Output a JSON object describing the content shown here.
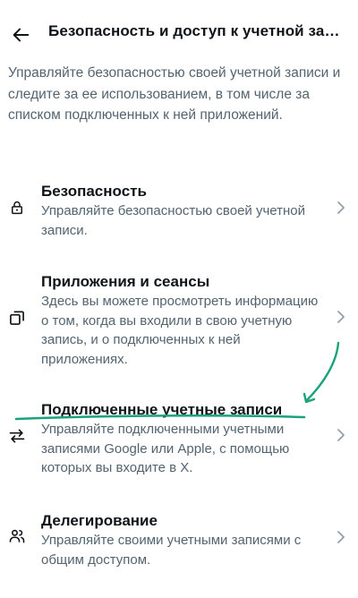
{
  "header": {
    "back_icon": "arrow-left-icon",
    "title": "Безопасность и доступ к учетной записи"
  },
  "intro": "Управляйте безопасностью своей учетной записи и следите за ее использованием, в том числе за списком подключенных к ней приложений.",
  "items": [
    {
      "icon": "lock-icon",
      "title": "Безопасность",
      "description": "Управляйте безопасностью своей учетной записи."
    },
    {
      "icon": "copy-windows-icon",
      "title": "Приложения и сеансы",
      "description": "Здесь вы можете просмотреть информацию о том, когда вы входили в свою учетную запись, и о подключенных к ней приложениях."
    },
    {
      "icon": "swap-arrows-icon",
      "title": "Подключенные учетные записи",
      "description": "Управляйте подключенными учетными записями Google или Apple, с помощью которых вы входите в X."
    },
    {
      "icon": "people-icon",
      "title": "Делегирование",
      "description": "Управляйте своими учетными записями с общим доступом."
    }
  ],
  "colors": {
    "text_primary": "#0f1419",
    "text_secondary": "#536471",
    "chevron": "#8b98a5",
    "annotation": "#1aa37a"
  }
}
